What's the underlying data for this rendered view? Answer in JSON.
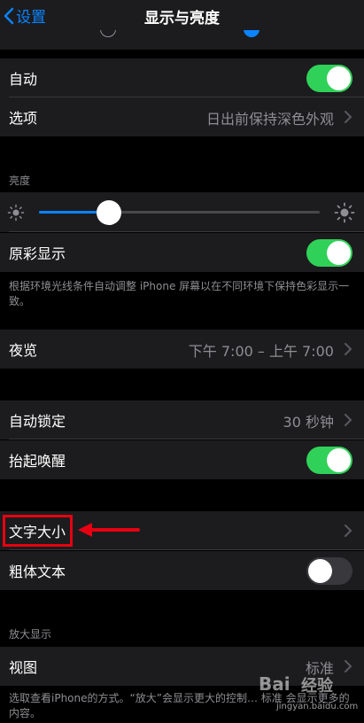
{
  "nav": {
    "back_label": "设置",
    "title": "显示与亮度"
  },
  "appearance": {
    "auto_label": "自动",
    "auto_on": true,
    "options_label": "选项",
    "options_value": "日出前保持深色外观"
  },
  "brightness": {
    "header": "亮度",
    "level": 0.25,
    "true_tone_label": "原彩显示",
    "true_tone_on": true,
    "footer": "根据环境光线条件自动调整 iPhone 屏幕以在不同环境下保持色彩显示一致。"
  },
  "night_shift": {
    "label": "夜览",
    "value": "下午 7:00 – 上午 7:00"
  },
  "lock": {
    "auto_lock_label": "自动锁定",
    "auto_lock_value": "30 秒钟",
    "raise_label": "抬起唤醒",
    "raise_on": true
  },
  "text": {
    "size_label": "文字大小",
    "bold_label": "粗体文本",
    "bold_on": false
  },
  "zoom": {
    "header": "放大显示",
    "view_label": "视图",
    "view_value": "标准",
    "footer": "选取查看iPhone的方式。“放大”会显示更大的控制… 标准 会显示更多的内容。"
  },
  "watermark": {
    "brand": "Bai",
    "name": "经验",
    "url": "jingyan.baidu.com"
  },
  "colors": {
    "accent": "#0a84ff",
    "toggle_on": "#30d158",
    "annotation": "#e60012"
  }
}
